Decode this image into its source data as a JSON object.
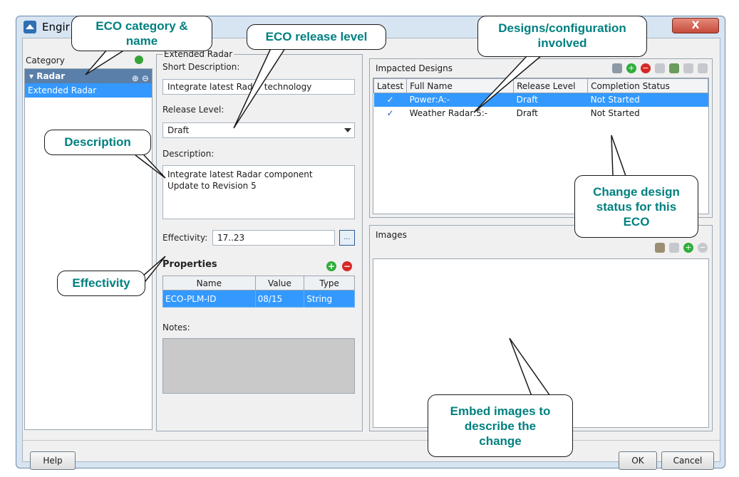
{
  "window": {
    "title": "Engir",
    "close_label": "X"
  },
  "category": {
    "label": "Category",
    "group": "▾ Radar",
    "group_icons": "⊕ ⊖",
    "item": "Extended Radar"
  },
  "eco": {
    "caption": "Extended Radar",
    "short_desc_label": "Short Description:",
    "short_desc_value": "Integrate latest Radar technology",
    "release_label": "Release Level:",
    "release_value": "Draft",
    "desc_label": "Description:",
    "desc_line1": "Integrate latest Radar component",
    "desc_line2": "Update to Revision 5",
    "effectivity_label": "Effectivity:",
    "effectivity_value": "17..23",
    "effectivity_button": "...",
    "properties_label": "Properties",
    "notes_label": "Notes:"
  },
  "properties_table": {
    "headers": [
      "Name",
      "Value",
      "Type"
    ],
    "rows": [
      [
        "ECO-PLM-ID",
        "08/15",
        "String"
      ]
    ]
  },
  "designs": {
    "title": "Impacted Designs",
    "headers": [
      "Latest",
      "Full Name",
      "Release Level",
      "Completion Status"
    ],
    "rows": [
      {
        "latest": "✓",
        "name": "Power:A:-",
        "release": "Draft",
        "status": "Not Started"
      },
      {
        "latest": "✓",
        "name": "Weather Radar:5:-",
        "release": "Draft",
        "status": "Not Started"
      }
    ]
  },
  "images": {
    "title": "Images"
  },
  "buttons": {
    "help": "Help",
    "ok": "OK",
    "cancel": "Cancel"
  },
  "callouts": {
    "category_name": [
      "ECO category &",
      "name"
    ],
    "release_level": "ECO release level",
    "designs": [
      "Designs/configuration",
      "involved"
    ],
    "description": "Description",
    "effectivity": "Effectivity",
    "design_status": [
      "Change design",
      "status for this",
      "ECO"
    ],
    "embed_images": [
      "Embed images to",
      "describe the",
      "change"
    ]
  },
  "colors": {
    "selection": "#3399ff",
    "callout_text": "#008080",
    "add": "#2fae3b",
    "remove": "#d62828"
  }
}
